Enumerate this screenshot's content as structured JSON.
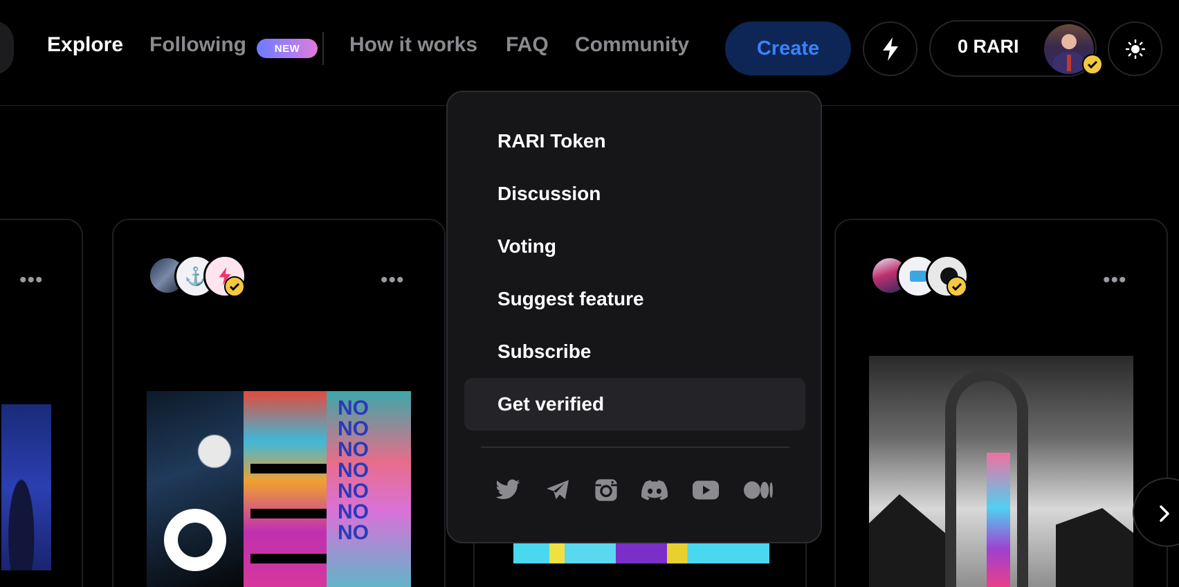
{
  "header": {
    "nav": {
      "explore": "Explore",
      "following": "Following",
      "following_badge": "NEW",
      "how_it_works": "How it works",
      "faq": "FAQ",
      "community": "Community"
    },
    "create_label": "Create",
    "activity_icon": "lightning-icon",
    "wallet_balance": "0 RARI",
    "theme_icon": "sun-icon"
  },
  "community_menu": {
    "items": [
      {
        "label": "RARI Token"
      },
      {
        "label": "Discussion"
      },
      {
        "label": "Voting"
      },
      {
        "label": "Suggest feature"
      },
      {
        "label": "Subscribe"
      },
      {
        "label": "Get verified",
        "hovered": true
      }
    ],
    "social_icons": [
      "twitter-icon",
      "telegram-icon",
      "instagram-icon",
      "discord-icon",
      "youtube-icon",
      "medium-icon"
    ]
  },
  "cards": {
    "more_label": "•••"
  },
  "colors": {
    "background": "#000000",
    "accent_blue": "#3a82ff",
    "create_bg": "#0e2656",
    "verified_badge": "#f5c842",
    "menu_bg": "#161619",
    "muted_text": "#8a8a8f"
  }
}
